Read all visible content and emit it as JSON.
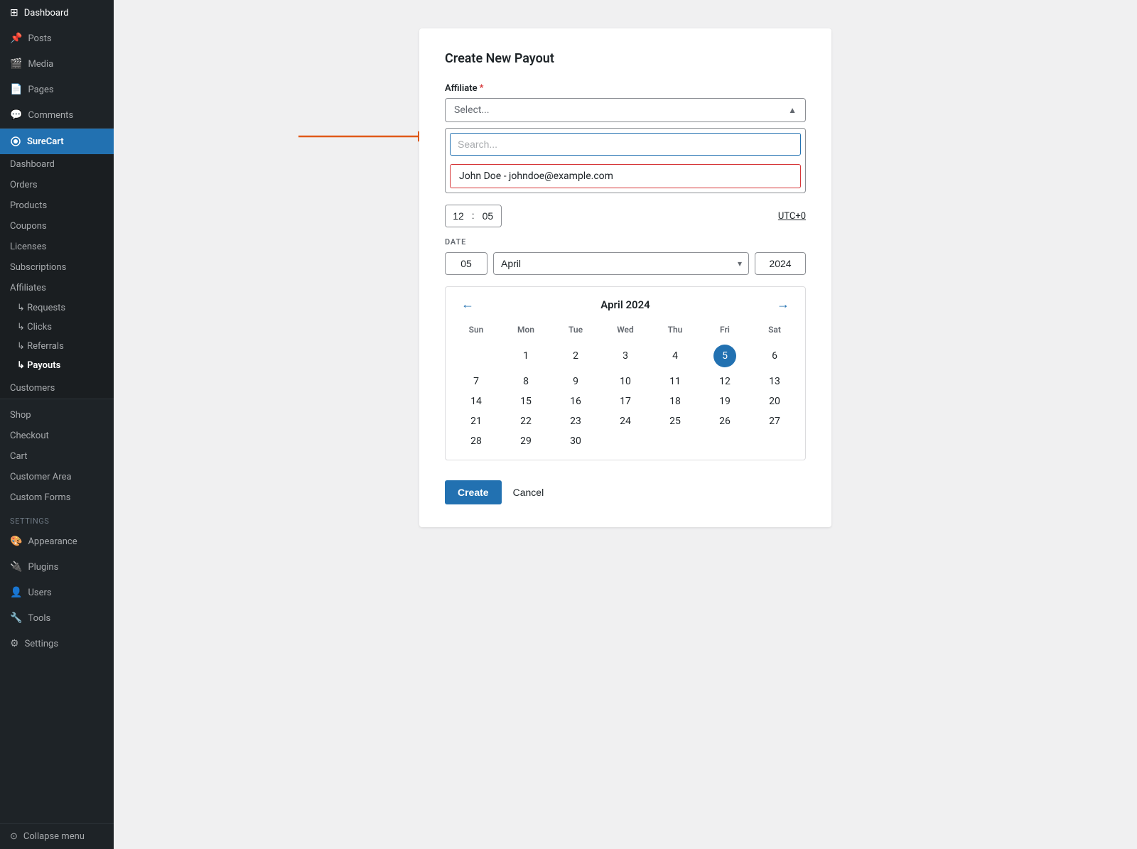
{
  "sidebar": {
    "top_items": [
      {
        "id": "dashboard-top",
        "label": "Dashboard",
        "icon": "⊞"
      },
      {
        "id": "posts",
        "label": "Posts",
        "icon": "📌"
      },
      {
        "id": "media",
        "label": "Media",
        "icon": "🎬"
      },
      {
        "id": "pages",
        "label": "Pages",
        "icon": "📄"
      },
      {
        "id": "comments",
        "label": "Comments",
        "icon": "💬"
      }
    ],
    "surecart_label": "SureCart",
    "surecart_items": [
      {
        "id": "sc-dashboard",
        "label": "Dashboard",
        "indent": false
      },
      {
        "id": "sc-orders",
        "label": "Orders",
        "indent": false
      },
      {
        "id": "sc-products",
        "label": "Products",
        "indent": false
      },
      {
        "id": "sc-coupons",
        "label": "Coupons",
        "indent": false
      },
      {
        "id": "sc-licenses",
        "label": "Licenses",
        "indent": false
      },
      {
        "id": "sc-subscriptions",
        "label": "Subscriptions",
        "indent": false
      },
      {
        "id": "sc-affiliates",
        "label": "Affiliates",
        "indent": false
      },
      {
        "id": "sc-requests",
        "label": "↳ Requests",
        "indent": true
      },
      {
        "id": "sc-clicks",
        "label": "↳ Clicks",
        "indent": true
      },
      {
        "id": "sc-referrals",
        "label": "↳ Referrals",
        "indent": true
      },
      {
        "id": "sc-payouts",
        "label": "↳ Payouts",
        "indent": true,
        "active": true
      },
      {
        "id": "sc-customers",
        "label": "Customers",
        "indent": false
      }
    ],
    "shop_items": [
      {
        "id": "shop",
        "label": "Shop"
      },
      {
        "id": "checkout",
        "label": "Checkout"
      },
      {
        "id": "cart",
        "label": "Cart"
      },
      {
        "id": "customer-area",
        "label": "Customer Area"
      },
      {
        "id": "custom-forms",
        "label": "Custom Forms"
      }
    ],
    "settings_label": "Settings",
    "bottom_items": [
      {
        "id": "appearance",
        "label": "Appearance",
        "icon": "🎨"
      },
      {
        "id": "plugins",
        "label": "Plugins",
        "icon": "🔌"
      },
      {
        "id": "users",
        "label": "Users",
        "icon": "👤"
      },
      {
        "id": "tools",
        "label": "Tools",
        "icon": "🔧"
      },
      {
        "id": "settings",
        "label": "Settings",
        "icon": "⚙"
      }
    ],
    "collapse_label": "Collapse menu"
  },
  "form": {
    "title": "Create New Payout",
    "affiliate_label": "Affiliate",
    "required_mark": "*",
    "select_placeholder": "Select...",
    "search_placeholder": "Search...",
    "dropdown_option": "John Doe - johndoe@example.com",
    "time_hour": "12",
    "time_minute": "05",
    "utc_label": "UTC+0",
    "date_label": "DATE",
    "date_day": "05",
    "date_month": "April",
    "date_year": "2024",
    "calendar_title": "April 2024",
    "calendar_days_of_week": [
      "Sun",
      "Mon",
      "Tue",
      "Wed",
      "Thu",
      "Fri",
      "Sat"
    ],
    "calendar_weeks": [
      [
        "",
        "1",
        "2",
        "3",
        "4",
        "5",
        "6"
      ],
      [
        "7",
        "8",
        "9",
        "10",
        "11",
        "12",
        "13"
      ],
      [
        "14",
        "15",
        "16",
        "17",
        "18",
        "19",
        "20"
      ],
      [
        "21",
        "22",
        "23",
        "24",
        "25",
        "26",
        "27"
      ],
      [
        "28",
        "29",
        "30",
        "",
        "",
        "",
        ""
      ]
    ],
    "selected_day": "5",
    "create_label": "Create",
    "cancel_label": "Cancel"
  }
}
